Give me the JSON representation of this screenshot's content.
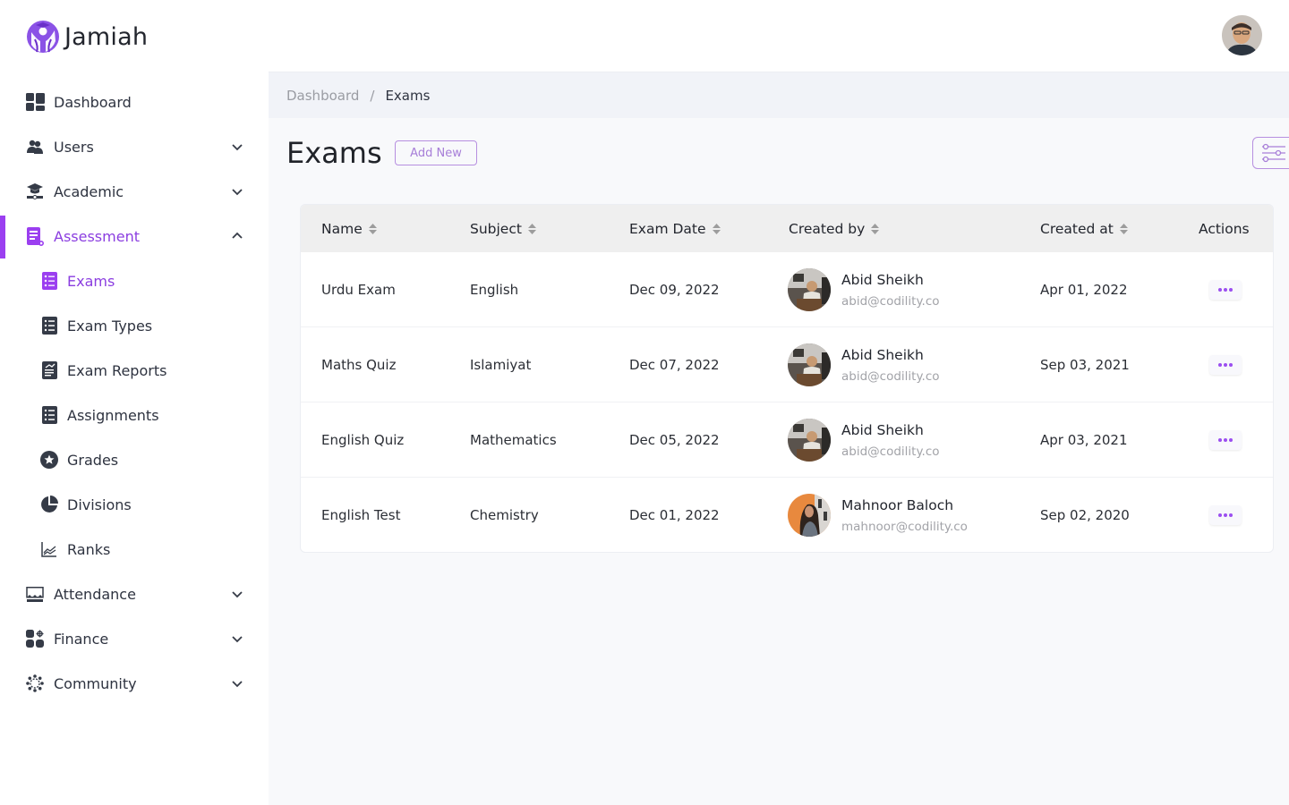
{
  "app": {
    "name": "Jamiah",
    "brand_color": "#8b3ee0"
  },
  "header": {
    "user_avatar": "user-profile-photo"
  },
  "sidebar": {
    "items": [
      {
        "label": "Dashboard",
        "icon": "dashboard-icon",
        "expandable": false
      },
      {
        "label": "Users",
        "icon": "users-icon",
        "expandable": true,
        "expanded": false
      },
      {
        "label": "Academic",
        "icon": "graduation-cap-icon",
        "expandable": true,
        "expanded": false
      },
      {
        "label": "Assessment",
        "icon": "assessment-icon",
        "expandable": true,
        "expanded": true,
        "active": true,
        "children": [
          {
            "label": "Exams",
            "icon": "checklist-icon",
            "active": true
          },
          {
            "label": "Exam Types",
            "icon": "list-icon"
          },
          {
            "label": "Exam Reports",
            "icon": "report-icon"
          },
          {
            "label": "Assignments",
            "icon": "list-icon"
          },
          {
            "label": "Grades",
            "icon": "star-circle-icon"
          },
          {
            "label": "Divisions",
            "icon": "pie-chart-icon"
          },
          {
            "label": "Ranks",
            "icon": "line-chart-icon"
          }
        ]
      },
      {
        "label": "Attendance",
        "icon": "attendance-icon",
        "expandable": true,
        "expanded": false
      },
      {
        "label": "Finance",
        "icon": "finance-icon",
        "expandable": true,
        "expanded": false
      },
      {
        "label": "Community",
        "icon": "community-icon",
        "expandable": true,
        "expanded": false
      }
    ]
  },
  "breadcrumb": {
    "items": [
      "Dashboard",
      "Exams"
    ],
    "separator": "/"
  },
  "page": {
    "title": "Exams",
    "add_new_label": "Add New",
    "filter_icon": "filter-sliders-icon"
  },
  "table": {
    "columns": [
      {
        "label": "Name",
        "sortable": true
      },
      {
        "label": "Subject",
        "sortable": true
      },
      {
        "label": "Exam Date",
        "sortable": true
      },
      {
        "label": "Created by",
        "sortable": true
      },
      {
        "label": "Created at",
        "sortable": true
      },
      {
        "label": "Actions",
        "sortable": false
      }
    ],
    "rows": [
      {
        "name": "Urdu Exam",
        "subject": "English",
        "exam_date": "Dec 09, 2022",
        "creator_name": "Abid Sheikh",
        "creator_email": "abid@codility.co",
        "created_at": "Apr 01, 2022",
        "avatar": "abid"
      },
      {
        "name": "Maths Quiz",
        "subject": "Islamiyat",
        "exam_date": "Dec 07, 2022",
        "creator_name": "Abid Sheikh",
        "creator_email": "abid@codility.co",
        "created_at": "Sep 03, 2021",
        "avatar": "abid"
      },
      {
        "name": "English Quiz",
        "subject": "Mathematics",
        "exam_date": "Dec 05, 2022",
        "creator_name": "Abid Sheikh",
        "creator_email": "abid@codility.co",
        "created_at": "Apr 03, 2021",
        "avatar": "abid"
      },
      {
        "name": "English Test",
        "subject": "Chemistry",
        "exam_date": "Dec 01, 2022",
        "creator_name": "Mahnoor Baloch",
        "creator_email": "mahnoor@codility.co",
        "created_at": "Sep 02, 2020",
        "avatar": "mahnoor"
      }
    ]
  }
}
